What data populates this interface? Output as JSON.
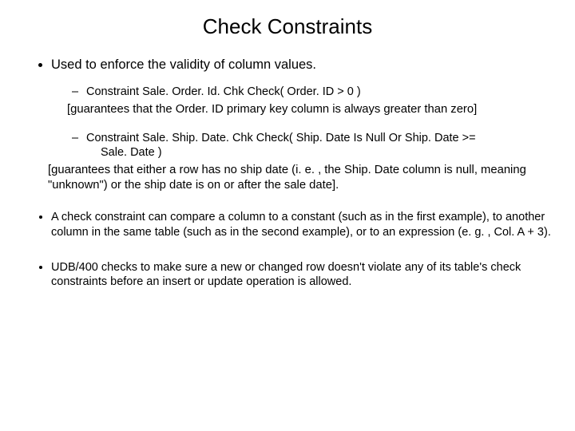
{
  "title": "Check Constraints",
  "bullets": {
    "b1": "Used to enforce the validity of column values.",
    "b1_sub1": "Constraint Sale. Order. Id. Chk Check( Order. ID > 0 )",
    "b1_note1": "[guarantees that the Order. ID primary key column is always greater than zero]",
    "b1_sub2_line1": "Constraint Sale. Ship. Date. Chk Check( Ship. Date Is Null Or Ship. Date >=",
    "b1_sub2_line2": "Sale. Date )",
    "b1_note2": "[guarantees that either a row has no ship date (i. e. , the Ship. Date column is null, meaning \"unknown\") or the ship date is on or after the sale date].",
    "b2": "A check constraint can compare a column to a constant (such as in the first example), to another column in the same table (such as in the second example), or to an expression (e. g. , Col. A + 3).",
    "b3": "UDB/400 checks to make sure a new or changed row doesn't violate any of its table's check constraints before an insert or update operation is allowed."
  }
}
